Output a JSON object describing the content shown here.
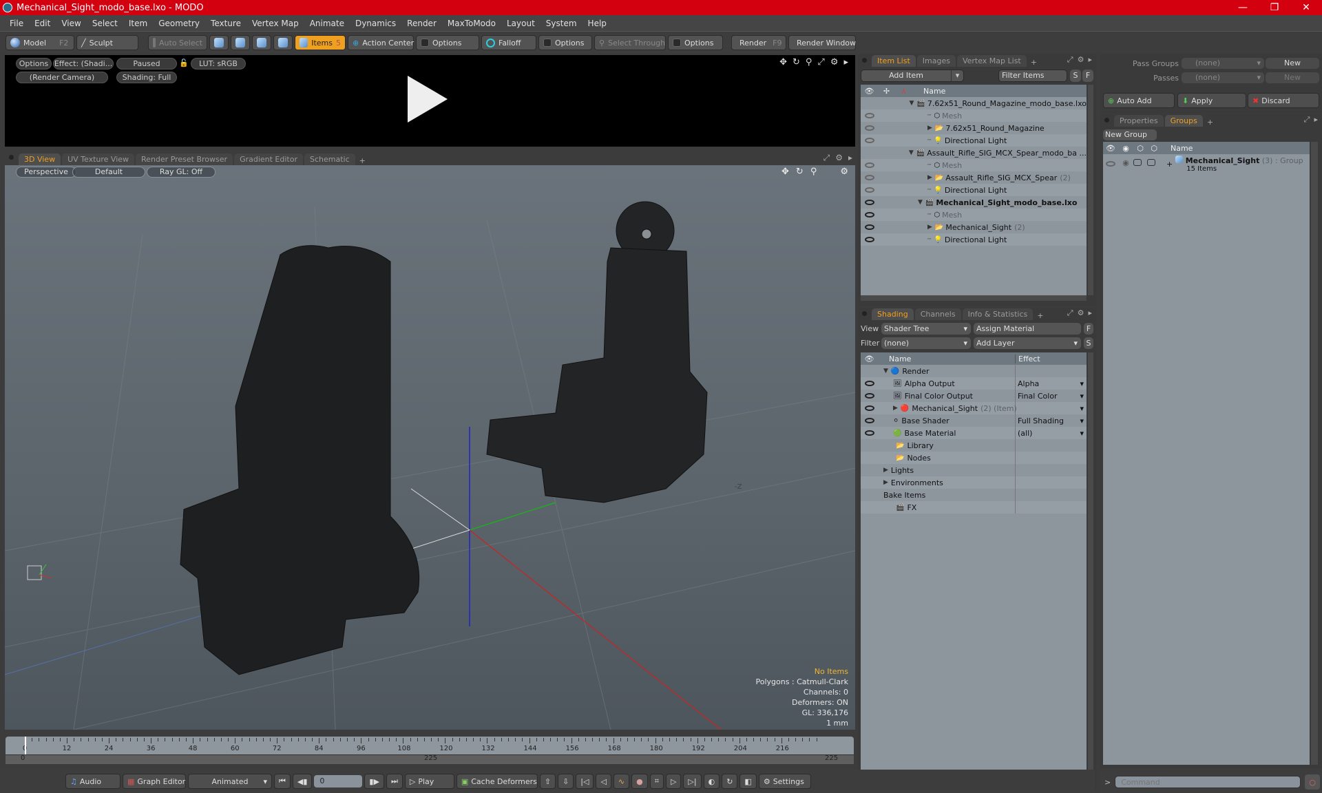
{
  "window": {
    "title": "Mechanical_Sight_modo_base.lxo - MODO",
    "controls": [
      "—",
      "❐",
      "✕"
    ]
  },
  "menu": [
    "File",
    "Edit",
    "View",
    "Select",
    "Item",
    "Geometry",
    "Texture",
    "Vertex Map",
    "Animate",
    "Dynamics",
    "Render",
    "MaxToModo",
    "Layout",
    "System",
    "Help"
  ],
  "toolbar": {
    "model": "Model",
    "model_key": "F2",
    "sculpt": "Sculpt",
    "auto_select": "Auto Select",
    "items": "Items",
    "items_key": "5",
    "action_center": "Action Center",
    "options1": "Options",
    "falloff": "Falloff",
    "options2": "Options",
    "select_through": "Select Through",
    "options3": "Options",
    "render": "Render",
    "render_key": "F9",
    "render_window": "Render Window"
  },
  "preview": {
    "options": "Options",
    "effect": "Effect: (Shadi...",
    "paused": "Paused",
    "lut": "LUT: sRGB",
    "camera": "(Render Camera)",
    "shading": "Shading: Full"
  },
  "viewport_tabs": {
    "tabs": [
      "3D View",
      "UV Texture View",
      "Render Preset Browser",
      "Gradient Editor",
      "Schematic"
    ],
    "active": "3D View",
    "add": "+"
  },
  "viewport": {
    "perspective": "Perspective",
    "default": "Default",
    "raygl": "Ray GL: Off",
    "info": {
      "selection": "No Items",
      "polygons": "Polygons : Catmull-Clark",
      "channels": "Channels: 0",
      "deformers": "Deformers: ON",
      "gl": "GL: 336,176",
      "unit": "1 mm"
    },
    "axis_label": "-Z"
  },
  "item_list": {
    "tabs": [
      "Item List",
      "Images",
      "Vertex Map List"
    ],
    "add": "+",
    "add_item": "Add Item",
    "filter": "Filter Items",
    "s": "S",
    "f": "F",
    "col_name": "Name",
    "rows": [
      {
        "indent": 1,
        "expand": "▼",
        "icon": "scene",
        "label": "7.62x51_Round_Magazine_modo_base.lxo",
        "eye": ""
      },
      {
        "indent": 2,
        "expand": "",
        "icon": "mesh",
        "label": "Mesh",
        "eye": "dim",
        "muted": true
      },
      {
        "indent": 2,
        "expand": "▶",
        "icon": "folder",
        "label": "7.62x51_Round_Magazine",
        "eye": "dim"
      },
      {
        "indent": 2,
        "expand": "",
        "icon": "light",
        "label": "Directional Light",
        "eye": "dim"
      },
      {
        "indent": 1,
        "expand": "▼",
        "icon": "scene",
        "label": "Assault_Rifle_SIG_MCX_Spear_modo_ba ...",
        "eye": ""
      },
      {
        "indent": 2,
        "expand": "",
        "icon": "mesh",
        "label": "Mesh",
        "eye": "dim",
        "muted": true
      },
      {
        "indent": 2,
        "expand": "▶",
        "icon": "folder",
        "label": "Assault_Rifle_SIG_MCX_Spear",
        "count": "(2)",
        "eye": "dim"
      },
      {
        "indent": 2,
        "expand": "",
        "icon": "light",
        "label": "Directional Light",
        "eye": "dim"
      },
      {
        "indent": 1,
        "expand": "▼",
        "icon": "scene",
        "label": "Mechanical_Sight_modo_base.lxo",
        "eye": "on",
        "bold": true
      },
      {
        "indent": 2,
        "expand": "",
        "icon": "mesh",
        "label": "Mesh",
        "eye": "on",
        "muted": true
      },
      {
        "indent": 2,
        "expand": "▶",
        "icon": "folder",
        "label": "Mechanical_Sight",
        "count": "(2)",
        "eye": "on"
      },
      {
        "indent": 2,
        "expand": "",
        "icon": "light",
        "label": "Directional Light",
        "eye": "on"
      }
    ]
  },
  "shading": {
    "tabs": [
      "Shading",
      "Channels",
      "Info & Statistics"
    ],
    "add": "+",
    "view_label": "View",
    "view_value": "Shader Tree",
    "assign_material": "Assign Material",
    "f": "F",
    "filter_label": "Filter",
    "filter_value": "(none)",
    "add_layer": "Add Layer",
    "s": "S",
    "col_name": "Name",
    "col_effect": "Effect",
    "rows": [
      {
        "indent": 0,
        "expand": "▼",
        "icon": "render",
        "label": "Render",
        "effect": "",
        "eye": false
      },
      {
        "indent": 1,
        "expand": "",
        "icon": "output",
        "label": "Alpha Output",
        "effect": "Alpha",
        "eye": true,
        "dd": true
      },
      {
        "indent": 1,
        "expand": "",
        "icon": "output",
        "label": "Final Color Output",
        "effect": "Final Color",
        "eye": true,
        "dd": true
      },
      {
        "indent": 1,
        "expand": "▶",
        "icon": "mask",
        "label": "Mechanical_Sight",
        "suffix": "(2) (Item)",
        "effect": "",
        "eye": true,
        "dd": true
      },
      {
        "indent": 1,
        "expand": "",
        "icon": "shader",
        "label": "Base Shader",
        "effect": "Full Shading",
        "eye": true,
        "dd": true
      },
      {
        "indent": 1,
        "expand": "",
        "icon": "material",
        "label": "Base Material",
        "effect": "(all)",
        "eye": true,
        "dd": true
      },
      {
        "indent": 0,
        "expand": "",
        "icon": "folder",
        "label": "Library",
        "effect": "",
        "eye": false
      },
      {
        "indent": 0,
        "expand": "",
        "icon": "folder",
        "label": "Nodes",
        "effect": "",
        "eye": false
      },
      {
        "indent": -1,
        "expand": "▶",
        "icon": "",
        "label": "Lights",
        "effect": "",
        "eye": false
      },
      {
        "indent": -1,
        "expand": "▶",
        "icon": "",
        "label": "Environments",
        "effect": "",
        "eye": false
      },
      {
        "indent": -1,
        "expand": "",
        "icon": "",
        "label": "Bake Items",
        "effect": "",
        "eye": false
      },
      {
        "indent": 0,
        "expand": "",
        "icon": "scene",
        "label": "FX",
        "effect": "",
        "eye": false
      }
    ]
  },
  "pass_panel": {
    "pass_groups": "Pass Groups",
    "pass_groups_value": "(none)",
    "new1": "New",
    "passes": "Passes",
    "passes_value": "(none)",
    "new2": "New",
    "auto_add": "Auto Add",
    "apply": "Apply",
    "discard": "Discard"
  },
  "groups": {
    "tabs": [
      "Properties",
      "Groups"
    ],
    "active": "Groups",
    "add": "+",
    "new_group": "New Group",
    "col_name": "Name",
    "group_name": "Mechanical_Sight",
    "group_count": "(3)",
    "group_type": ": Group",
    "group_items": "15 Items"
  },
  "timeline": {
    "ticks": [
      0,
      12,
      24,
      36,
      48,
      60,
      72,
      84,
      96,
      108,
      120,
      132,
      144,
      156,
      168,
      180,
      192,
      204,
      216
    ],
    "range_start": "0",
    "range_mid": "225",
    "range_end": "225",
    "current": 0
  },
  "bottom": {
    "audio": "Audio",
    "graph_editor": "Graph Editor",
    "animated": "Animated",
    "frame": "0",
    "play": "Play",
    "cache_deformers": "Cache Deformers",
    "settings": "Settings",
    "command_placeholder": "Command",
    "prompt": ">"
  }
}
